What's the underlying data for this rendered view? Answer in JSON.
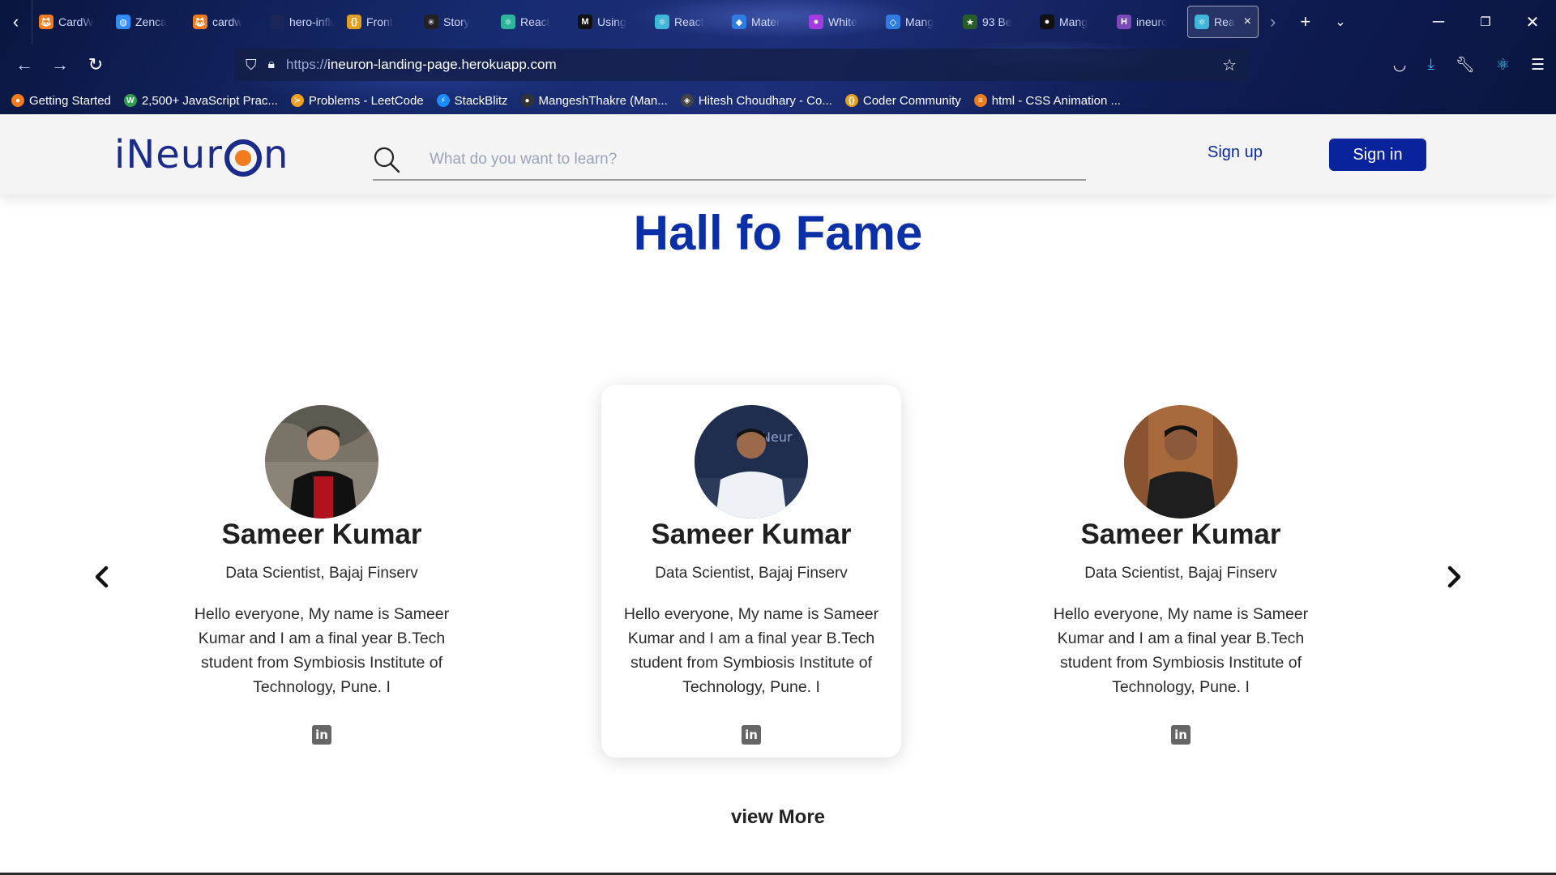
{
  "browser": {
    "tabs": [
      {
        "label": "CardW",
        "icon": "fox-icon",
        "color": "#f07c1e"
      },
      {
        "label": "Zenca",
        "icon": "globe-icon",
        "color": "#2f8cff"
      },
      {
        "label": "cardw",
        "icon": "fox-icon",
        "color": "#f07c1e"
      },
      {
        "label": "hero-influ",
        "icon": "blank-icon",
        "color": "#1b2557"
      },
      {
        "label": "Front",
        "icon": "braces-icon",
        "color": "#e0a020"
      },
      {
        "label": "Story",
        "icon": "spark-icon",
        "color": "#222222"
      },
      {
        "label": "React",
        "icon": "atom-icon",
        "color": "#2bb59a"
      },
      {
        "label": "Using",
        "icon": "m-icon",
        "color": "#111111"
      },
      {
        "label": "React",
        "icon": "atom-icon",
        "color": "#40b6d8"
      },
      {
        "label": "Mater",
        "icon": "mui-icon",
        "color": "#2f7de1"
      },
      {
        "label": "White",
        "icon": "drop-icon",
        "color": "#a23ce0"
      },
      {
        "label": "Mang",
        "icon": "code-icon",
        "color": "#2f7de1"
      },
      {
        "label": "93 Be",
        "icon": "badge-icon",
        "color": "#2a5c2a"
      },
      {
        "label": "Mang",
        "icon": "github-icon",
        "color": "#111111"
      },
      {
        "label": "ineuro",
        "icon": "h-icon",
        "color": "#7a4ab8"
      }
    ],
    "active_tab": {
      "label": "Rea",
      "icon": "atom-icon",
      "color": "#40b6d8"
    },
    "url_protocol": "https://",
    "url_host": "ineuron-landing-page.herokuapp.com",
    "bookmarks": [
      {
        "label": "Getting Started",
        "icon": "firefox-icon",
        "color": "#f07c1e"
      },
      {
        "label": "2,500+ JavaScript Prac...",
        "icon": "w3-icon",
        "color": "#2e9e4a"
      },
      {
        "label": "Problems - LeetCode",
        "icon": "leetcode-icon",
        "color": "#f0a020"
      },
      {
        "label": "StackBlitz",
        "icon": "bolt-icon",
        "color": "#1a8cff"
      },
      {
        "label": "MangeshThakre (Man...",
        "icon": "github-icon",
        "color": "#333333"
      },
      {
        "label": "Hitesh Choudhary - Co...",
        "icon": "cube-icon",
        "color": "#444444"
      },
      {
        "label": "Coder Community",
        "icon": "braces-icon",
        "color": "#e0a020"
      },
      {
        "label": "html - CSS Animation ...",
        "icon": "stack-icon",
        "color": "#f07c1e"
      }
    ]
  },
  "header": {
    "logo_prefix": "iNeur",
    "logo_suffix": "n",
    "search_placeholder": "What do you want to learn?",
    "signup_label": "Sign up",
    "signin_label": "Sign in"
  },
  "section": {
    "title": "Hall fo Fame",
    "view_more": "view More"
  },
  "cards": [
    {
      "name": "Sameer Kumar",
      "role": "Data Scientist, Bajaj Finserv",
      "bio": "Hello everyone, My name is Sameer Kumar and I am a final year B.Tech student from Symbiosis Institute of Technology, Pune. I",
      "active": false
    },
    {
      "name": "Sameer Kumar",
      "role": "Data Scientist, Bajaj Finserv",
      "bio": "Hello everyone, My name is Sameer Kumar and I am a final year B.Tech student from Symbiosis Institute of Technology, Pune. I",
      "active": true
    },
    {
      "name": "Sameer Kumar",
      "role": "Data Scientist, Bajaj Finserv",
      "bio": "Hello everyone, My name is Sameer Kumar and I am a final year B.Tech student from Symbiosis Institute of Technology, Pune. I",
      "active": false
    }
  ],
  "colors": {
    "brand_blue": "#0b2fa6",
    "button_blue": "#08239c",
    "logo_orange": "#f07c1e"
  }
}
